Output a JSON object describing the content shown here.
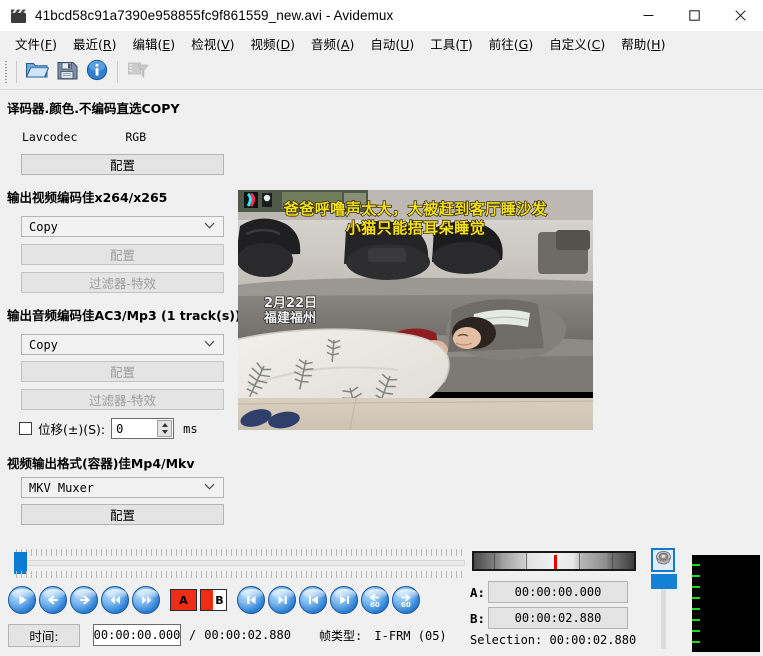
{
  "window": {
    "title": "41bcd58c91a7390e958855fc9f861559_new.avi - Avidemux",
    "icon": "film-clapper-icon",
    "minimize": "—",
    "maximize": "□",
    "close": "✕"
  },
  "menu": [
    {
      "label": "文件",
      "mnemonic": "F"
    },
    {
      "label": "最近",
      "mnemonic": "R"
    },
    {
      "label": "编辑",
      "mnemonic": "E"
    },
    {
      "label": "检视",
      "mnemonic": "V"
    },
    {
      "label": "视频",
      "mnemonic": "D"
    },
    {
      "label": "音频",
      "mnemonic": "A"
    },
    {
      "label": "自动",
      "mnemonic": "U"
    },
    {
      "label": "工具",
      "mnemonic": "T"
    },
    {
      "label": "前往",
      "mnemonic": "G"
    },
    {
      "label": "自定义",
      "mnemonic": "C"
    },
    {
      "label": "帮助",
      "mnemonic": "H"
    }
  ],
  "toolbar": {
    "buttons": [
      {
        "name": "open-file-icon",
        "enabled": true
      },
      {
        "name": "save-file-icon",
        "enabled": true
      },
      {
        "name": "info-icon",
        "enabled": true
      },
      {
        "name": "video-filter-icon",
        "enabled": false
      }
    ]
  },
  "left_panel": {
    "video_decoder": {
      "heading": "译码器.颜色.不编码直选COPY",
      "codec": "Lavcodec",
      "colorspace": "RGB",
      "configure_label": "配置"
    },
    "video_output": {
      "heading": "输出视频编码佳x264/x265",
      "selected": "Copy",
      "configure_label": "配置",
      "filters_label": "过滤器-特效"
    },
    "audio_output": {
      "heading": "输出音频编码佳AC3/Mp3 (1 track(s))",
      "selected": "Copy",
      "configure_label": "配置",
      "filters_label": "过滤器-特效",
      "shift_label": "位移(±)(S):",
      "shift_value": "0",
      "shift_unit": "ms",
      "shift_checked": false
    },
    "output_format": {
      "heading": "视频输出格式(容器)佳Mp4/Mkv",
      "selected": "MKV Muxer",
      "configure_label": "配置"
    }
  },
  "preview": {
    "overlay_title_line1": "爸爸呼噜声太大，大被赶到客厅睡沙发",
    "overlay_title_line2": "小猫只能捂耳朵睡觉",
    "overlay_date": "2月22日",
    "overlay_place": "福建福州",
    "overlay_color": "#f2e21c"
  },
  "timeline": {
    "position_pct": 0
  },
  "transport": {
    "buttons": [
      {
        "name": "play-button",
        "glyph": "play"
      },
      {
        "name": "step-backward-button",
        "glyph": "arrow-left"
      },
      {
        "name": "step-forward-button",
        "glyph": "arrow-right"
      },
      {
        "name": "rewind-button",
        "glyph": "double-left"
      },
      {
        "name": "fast-forward-button",
        "glyph": "double-right"
      },
      {
        "name": "marker-a-button",
        "glyph": "A"
      },
      {
        "name": "marker-b-button",
        "glyph": "B"
      },
      {
        "name": "prev-keyframe-button",
        "glyph": "to-start"
      },
      {
        "name": "next-keyframe-button",
        "glyph": "to-end"
      },
      {
        "name": "prev-black-frame-button",
        "glyph": "skip-back"
      },
      {
        "name": "next-black-frame-button",
        "glyph": "skip-fwd"
      },
      {
        "name": "back-60-button",
        "glyph": "back60"
      },
      {
        "name": "forward-60-button",
        "glyph": "fwd60"
      }
    ]
  },
  "status": {
    "time_label": "时间:",
    "current_time": "00:00:00.000",
    "separator": "/",
    "total_time": "00:00:02.880",
    "frame_type_label": "帧类型:",
    "frame_type_value": "I-FRM (05)"
  },
  "selection": {
    "a_label": "A:",
    "a_value": "00:00:00.000",
    "b_label": "B:",
    "b_value": "00:00:02.880",
    "selection_text": "Selection: 00:00:02.880"
  },
  "audio": {
    "speaker_icon": "speaker-icon",
    "volume_pct": 100
  },
  "colors": {
    "accent": "#0a7bd4",
    "marker_red": "#e40000",
    "vu_green": "#14e014",
    "window_bg": "#f0f0f0"
  }
}
